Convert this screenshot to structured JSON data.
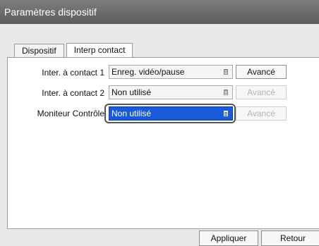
{
  "window": {
    "title": "Paramètres dispositif"
  },
  "tabs": [
    {
      "label": "Dispositif"
    },
    {
      "label": "Interp contact"
    }
  ],
  "rows": [
    {
      "label": "Inter. à contact 1",
      "value": "Enreg. vidéo/pause",
      "button": "Avancé",
      "button_enabled": true
    },
    {
      "label": "Inter. à contact 2",
      "value": "Non utilisé",
      "button": "Avancé",
      "button_enabled": false
    },
    {
      "label": "Moniteur Contrôle",
      "value": "Non utilisé",
      "button": "Avancé",
      "button_enabled": false,
      "focused": true
    }
  ],
  "footer": {
    "apply_label": "Appliquer",
    "back_label": "Retour"
  },
  "colors": {
    "focus_select": "#1a5ad8",
    "titlebar": "#6b6b6b",
    "disabled_text": "#b5b5b5"
  }
}
